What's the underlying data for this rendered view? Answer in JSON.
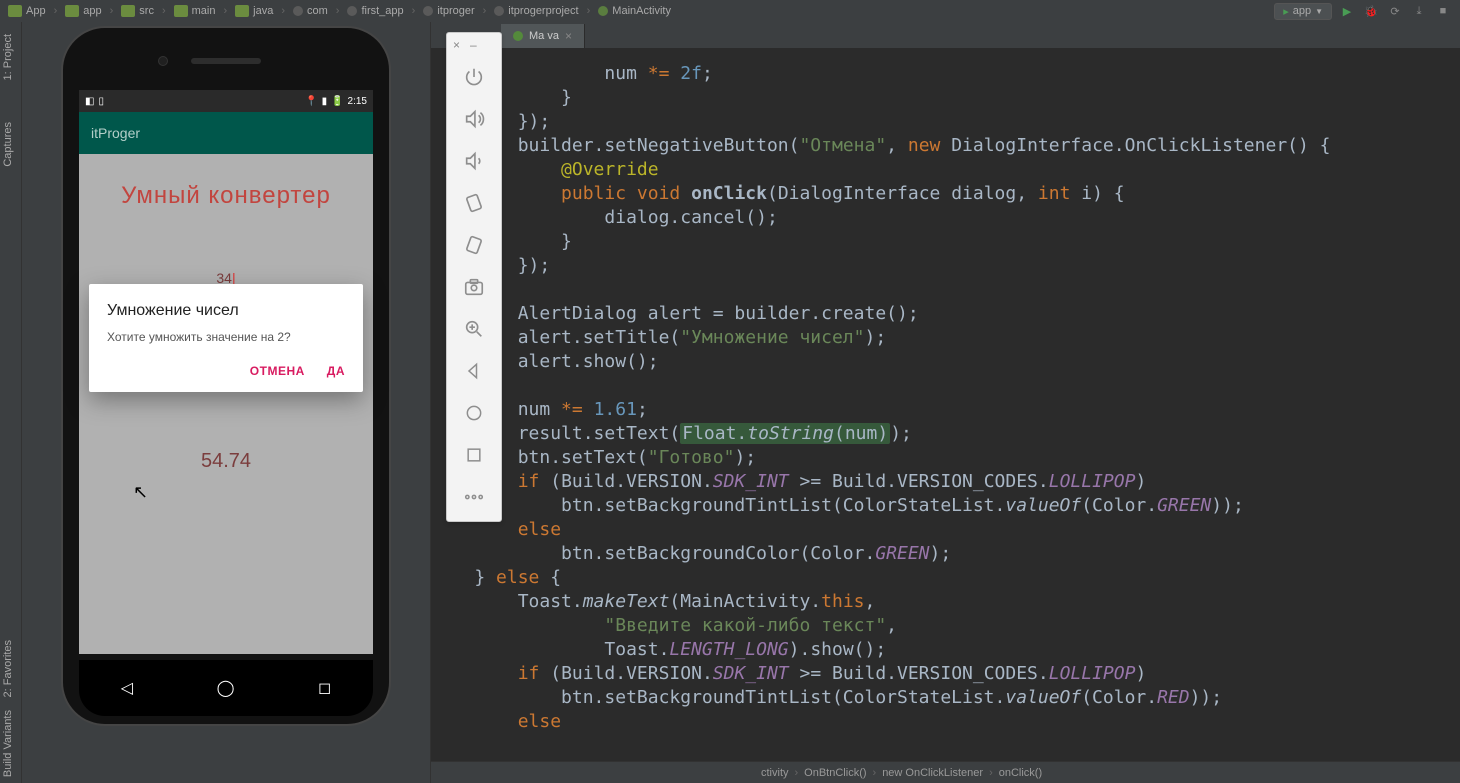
{
  "breadcrumb": [
    "App",
    "app",
    "src",
    "main",
    "java",
    "com",
    "first_app",
    "itproger",
    "itprogerproject",
    "MainActivity"
  ],
  "run_config": {
    "label": "app"
  },
  "left_gutter": {
    "project": "1: Project",
    "captures": "Captures",
    "favorites": "2: Favorites",
    "build_variants": "Build Variants"
  },
  "editor_tab": {
    "label": "Ma           va"
  },
  "emulator_titlebar": {
    "close": "×",
    "min": "–"
  },
  "phone": {
    "status_time": "2:15",
    "app_bar_title": "itProger",
    "heading": "Умный конвертер",
    "input_value": "34",
    "result_value": "54.74",
    "dialog": {
      "title": "Умножение чисел",
      "message": "Хотите умножить значение на 2?",
      "cancel": "ОТМЕНА",
      "ok": "ДА"
    },
    "nav": {
      "back": "◁",
      "home": "◯",
      "recent": "◻"
    }
  },
  "code_tokens": {
    "l1a": "                num ",
    "l1b": "*=",
    "l1c": " ",
    "l1d": "2f",
    "l1e": ";",
    "l2": "            }",
    "l3": "        });",
    "l4a": "        builder.setNegativeButton(",
    "l4b": "\"Отмена\"",
    "l4c": ", ",
    "l4d": "new",
    "l4e": " DialogInterface.OnClickListener() {",
    "l5a": "            ",
    "l5b": "@Override",
    "l6a": "            ",
    "l6b": "public",
    "l6c": " ",
    "l6d": "void",
    "l6e": " ",
    "l6f": "onClick",
    "l6g": "(DialogInterface dialog, ",
    "l6h": "int",
    "l6i": " i) {",
    "l7": "                dialog.cancel();",
    "l8": "            }",
    "l9": "        });",
    "l10": "",
    "l11": "        AlertDialog alert = builder.create();",
    "l12a": "        alert.setTitle(",
    "l12b": "\"Умножение чисел\"",
    "l12c": ");",
    "l13": "        alert.show();",
    "l14": "",
    "l15a": "        num ",
    "l15b": "*=",
    "l15c": " ",
    "l15d": "1.61",
    "l15e": ";",
    "l16a": "        result.setText(",
    "l16b": "Float.",
    "l16c": "toString",
    "l16d": "(",
    "l16e": "num",
    "l16f": ")",
    "l16g": ");",
    "l17a": "        btn.setText(",
    "l17b": "\"Готово\"",
    "l17c": ");",
    "l18a": "        ",
    "l18b": "if",
    "l18c": " (Build.VERSION.",
    "l18d": "SDK_INT",
    "l18e": " >= Build.VERSION_CODES.",
    "l18f": "LOLLIPOP",
    "l18g": ")",
    "l19a": "            btn.setBackgroundTintList(ColorStateList.",
    "l19b": "valueOf",
    "l19c": "(Color.",
    "l19d": "GREEN",
    "l19e": "));",
    "l20a": "        ",
    "l20b": "else",
    "l21a": "            btn.setBackgroundColor(Color.",
    "l21b": "GREEN",
    "l21c": ");",
    "l22a": "    } ",
    "l22b": "else",
    "l22c": " {",
    "l23a": "        Toast.",
    "l23b": "makeText",
    "l23c": "(MainActivity.",
    "l23d": "this",
    "l23e": ",",
    "l24a": "                ",
    "l24b": "\"Введите какой-либо текст\"",
    "l24c": ",",
    "l25a": "                Toast.",
    "l25b": "LENGTH_LONG",
    "l25c": ").show();",
    "l26a": "        ",
    "l26b": "if",
    "l26c": " (Build.VERSION.",
    "l26d": "SDK_INT",
    "l26e": " >= Build.VERSION_CODES.",
    "l26f": "LOLLIPOP",
    "l26g": ")",
    "l27a": "            btn.setBackgroundTintList(ColorStateList.",
    "l27b": "valueOf",
    "l27c": "(Color.",
    "l27d": "RED",
    "l27e": "));",
    "l28a": "        ",
    "l28b": "else"
  },
  "bottom_crumbs": [
    "ctivity",
    "OnBtnClick()",
    "new OnClickListener",
    "onClick()"
  ]
}
